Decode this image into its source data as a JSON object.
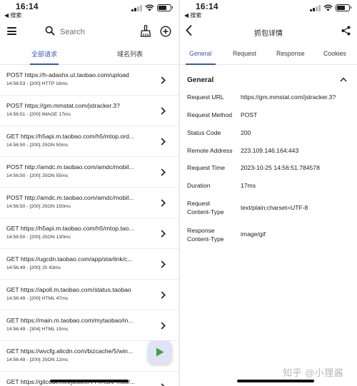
{
  "status_bar": {
    "time": "16:14",
    "back_app": "◀ 搜索"
  },
  "left": {
    "search_placeholder": "Search",
    "tabs": [
      "全部请求",
      "域名列表"
    ],
    "requests": [
      {
        "url": "POST https://h-adashx.ut.taobao.com/upload",
        "meta": "14:56:53 - [200]  HTTP 16ms"
      },
      {
        "url": "POST https://gm.mmstat.com/jstracker.3?",
        "meta": "14:56:51 - [200]  IMAGE 17ms"
      },
      {
        "url": "GET https://h5api.m.taobao.com/h5/mtop.ord...",
        "meta": "14:56:50 - [200]  JSON 50ms"
      },
      {
        "url": "POST http://amdc.m.taobao.com/amdc/mobil...",
        "meta": "14:56:50 - [200]  JSON 55ms"
      },
      {
        "url": "POST http://amdc.m.taobao.com/amdc/mobil...",
        "meta": "14:56:50 - [200]  JSON 150ms"
      },
      {
        "url": "GET https://h5api.m.taobao.com/h5/mtop.tao...",
        "meta": "14:56:50 - [200]  JSON 130ms"
      },
      {
        "url": "GET https://ugcdn.taobao.com/app/starlink/c...",
        "meta": "14:56:49 - [200]  JS 43ms"
      },
      {
        "url": "GET https://apoll.m.taobao.com/status.taobao",
        "meta": "14:56:49 - [200]  HTML 47ms"
      },
      {
        "url": "GET https://main.m.taobao.com/mytaobao/in...",
        "meta": "14:56:49 - [304]  HTML 15ms"
      },
      {
        "url": "GET https://wvcfg.alicdn.com/bizcache/5/win...",
        "meta": "14:56:49 - [200]  JSON 12ms"
      },
      {
        "url": "GET https://gitcode.net/justice/TTTASK/-/raw/...",
        "meta": ""
      }
    ]
  },
  "right": {
    "title": "抓包详情",
    "tabs": [
      "General",
      "Request",
      "Response",
      "Cookies"
    ],
    "section_title": "General",
    "fields": [
      {
        "label": "Request URL",
        "value": "https://gm.mmstat.com/jstracker.3?"
      },
      {
        "label": "Request Method",
        "value": "POST"
      },
      {
        "label": "Status Code",
        "value": "200"
      },
      {
        "label": "Remote Address",
        "value": "223.109.146.164:443"
      },
      {
        "label": "Request Time",
        "value": "2023-10-25 14:56:51.784578"
      },
      {
        "label": "Duration",
        "value": "17ms"
      },
      {
        "label": "Request Content-Type",
        "value": "text/plain;charset=UTF-8"
      },
      {
        "label": "Response Content-Type",
        "value": "image/gif"
      }
    ],
    "watermark": "知乎 @小狸酱"
  },
  "colors": {
    "accent": "#3b55b8",
    "fab_bg": "#dfe3f3",
    "play_green": "#3aa34a"
  },
  "icons": [
    "menu-icon",
    "search-icon",
    "broom-icon",
    "add-circle-icon",
    "chevron-right-icon",
    "play-icon",
    "back-arrow-icon",
    "share-icon",
    "chevron-up-icon"
  ]
}
